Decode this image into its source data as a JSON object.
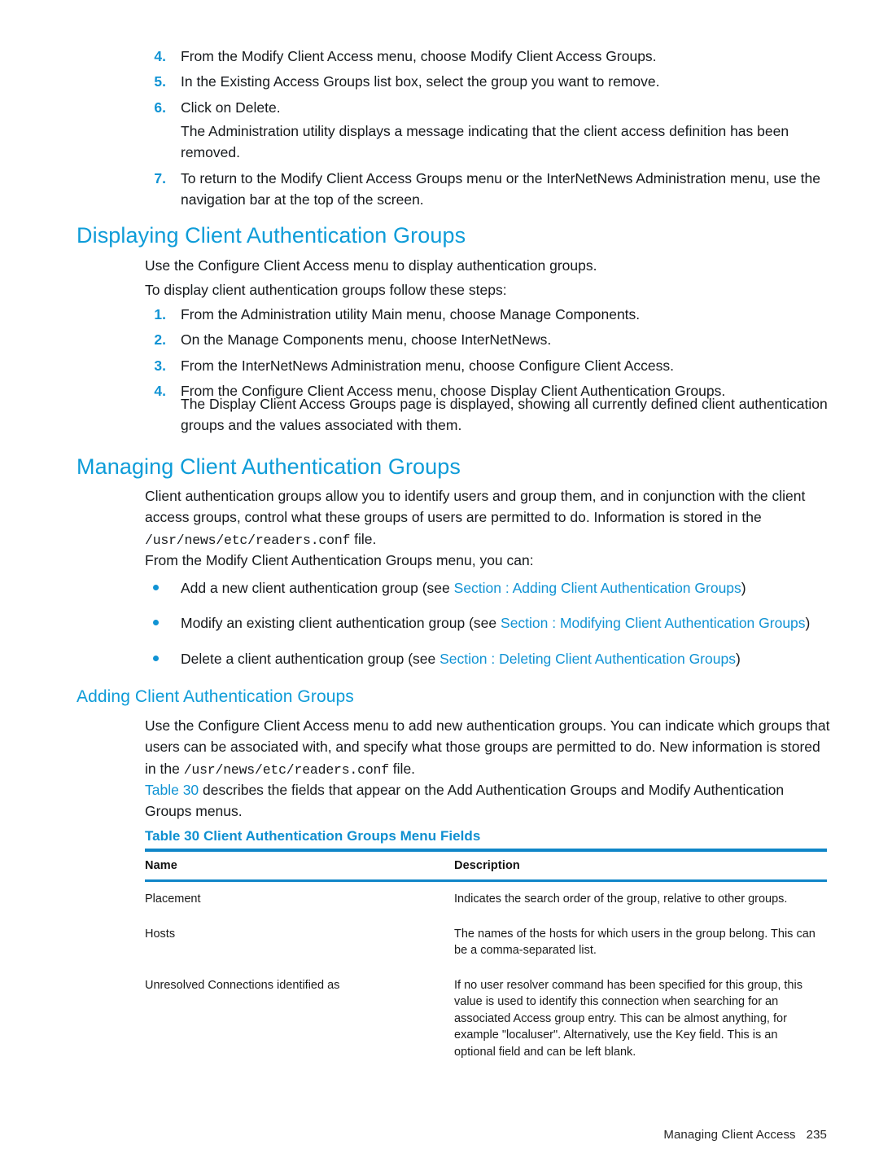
{
  "document": {
    "steps_continued": [
      {
        "num": "4.",
        "text": "From the Modify Client Access menu, choose Modify Client Access Groups."
      },
      {
        "num": "5.",
        "text": "In the Existing Access Groups list box, select the group you want to remove."
      },
      {
        "num": "6.",
        "text": "Click on Delete."
      }
    ],
    "step6_result": "The Administration utility displays a message indicating that the client access definition has been removed.",
    "step7": {
      "num": "7.",
      "text": "To return to the Modify Client Access Groups menu or the InterNetNews Administration menu, use the navigation bar at the top of the screen."
    },
    "section_displaying": {
      "heading": "Displaying Client Authentication Groups",
      "intro1": "Use the Configure Client Access menu to display authentication groups.",
      "intro2": "To display client authentication groups follow these steps:",
      "steps": [
        {
          "num": "1.",
          "text": "From the Administration utility Main menu, choose Manage Components."
        },
        {
          "num": "2.",
          "text": "On the Manage Components menu, choose InterNetNews."
        },
        {
          "num": "3.",
          "text": "From the InterNetNews Administration menu, choose Configure Client Access."
        },
        {
          "num": "4.",
          "text": "From the Configure Client Access menu, choose Display Client Authentication Groups."
        }
      ],
      "result": "The Display Client Access Groups page is displayed, showing all currently defined client authentication groups and the values associated with them."
    },
    "section_managing": {
      "heading": "Managing Client Authentication Groups",
      "para1_before": "Client authentication groups allow you to identify users and group them, and in conjunction with the client access groups, control what these groups of users are permitted to do. Information is stored in the ",
      "para1_path": "/usr/news/etc/readers.conf",
      "para1_after": " file.",
      "para2": "From the Modify Client Authentication Groups menu, you can:",
      "bullets": [
        {
          "lead": "Add a new client authentication group (see ",
          "link": "Section : Adding Client Authentication Groups",
          "tail": ")"
        },
        {
          "lead": "Modify an existing client authentication group (see ",
          "link": "Section : Modifying Client Authentication Groups",
          "tail": ")"
        },
        {
          "lead": "Delete a client authentication group (see ",
          "link": "Section : Deleting Client Authentication Groups",
          "tail": ")"
        }
      ]
    },
    "section_adding": {
      "heading": "Adding Client Authentication Groups",
      "para1_before": "Use the Configure Client Access menu to add new authentication groups. You can indicate which groups that users can be associated with, and specify what those groups are permitted to do. New information is stored in the ",
      "para1_path": "/usr/news/etc/readers.conf",
      "para1_after": " file.",
      "para2_link": "Table 30",
      "para2_text": " describes the fields that appear on the Add Authentication Groups and Modify Authentication Groups menus."
    },
    "table": {
      "caption": "Table 30 Client Authentication Groups Menu Fields",
      "headers": [
        "Name",
        "Description"
      ],
      "rows": [
        {
          "name": "Placement",
          "description": "Indicates the search order of the group, relative to other groups."
        },
        {
          "name": "Hosts",
          "description": "The names of the hosts for which users in the group belong. This can be a comma-separated list."
        },
        {
          "name": "Unresolved Connections identified as",
          "description": "If no user resolver command has been specified for this group, this value is used to identify this connection when searching for an associated Access group entry. This can be almost anything, for example \"localuser\". Alternatively, use the Key field. This is an optional field and can be left blank."
        }
      ]
    },
    "footer": {
      "title": "Managing Client Access",
      "page": "235"
    },
    "colors": {
      "heading_blue": "#0e9cd8",
      "link_blue": "#1093d4",
      "rule_blue": "#1086c8",
      "body_text": "#16191c"
    }
  }
}
